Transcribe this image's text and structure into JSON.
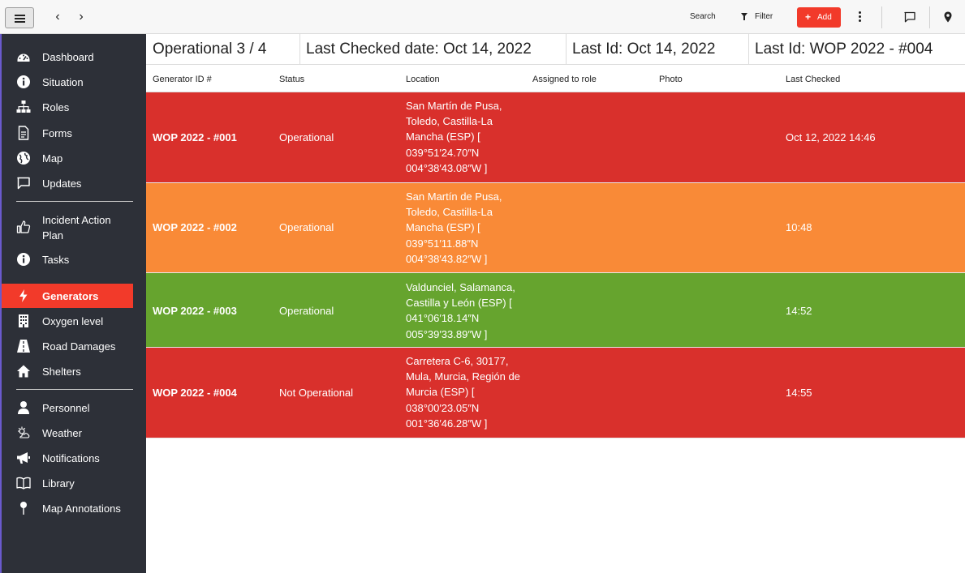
{
  "topbar": {
    "search_label": "Search",
    "filter_label": "Filter",
    "add_label": "Add"
  },
  "sidebar": {
    "items": [
      {
        "label": "Dashboard",
        "icon": "dashboard-icon"
      },
      {
        "label": "Situation",
        "icon": "info-icon"
      },
      {
        "label": "Roles",
        "icon": "org-chart-icon"
      },
      {
        "label": "Forms",
        "icon": "document-icon"
      },
      {
        "label": "Map",
        "icon": "globe-icon"
      },
      {
        "label": "Updates",
        "icon": "chat-icon"
      },
      {
        "label": "Incident Action Plan",
        "icon": "thumbs-up-icon"
      },
      {
        "label": "Tasks",
        "icon": "info-icon"
      },
      {
        "label": "Generators",
        "icon": "bolt-icon",
        "active": true
      },
      {
        "label": "Oxygen level",
        "icon": "building-icon"
      },
      {
        "label": "Road Damages",
        "icon": "road-icon"
      },
      {
        "label": "Shelters",
        "icon": "home-icon"
      },
      {
        "label": "Personnel",
        "icon": "person-icon"
      },
      {
        "label": "Weather",
        "icon": "weather-icon"
      },
      {
        "label": "Notifications",
        "icon": "megaphone-icon"
      },
      {
        "label": "Library",
        "icon": "book-icon"
      },
      {
        "label": "Map Annotations",
        "icon": "pin-icon"
      }
    ],
    "active_color": "#f23a2a",
    "background_color": "#2d3038"
  },
  "summary": {
    "operational": "Operational 3 / 4",
    "last_checked": "Last Checked date: Oct 14, 2022",
    "last_id_date": "Last Id: Oct 14, 2022",
    "last_id": "Last Id: WOP 2022 - #004"
  },
  "table": {
    "columns": [
      "Generator ID #",
      "Status",
      "Location",
      "Assigned to role",
      "Photo",
      "Last Checked"
    ],
    "rows": [
      {
        "id": "WOP 2022 - #001",
        "status": "Operational",
        "location": "San Martín de Pusa, Toledo, Castilla-La Mancha (ESP) [ 039°51′24.70″N 004°38′43.08″W ]",
        "role": "",
        "photo": "",
        "last_checked": "Oct 12, 2022 14:46",
        "color": "#d9302c"
      },
      {
        "id": "WOP 2022 - #002",
        "status": "Operational",
        "location": "San Martín de Pusa, Toledo, Castilla-La Mancha (ESP) [ 039°51′11.88″N 004°38′43.82″W ]",
        "role": "",
        "photo": "",
        "last_checked": "10:48",
        "color": "#f98a37"
      },
      {
        "id": "WOP 2022 - #003",
        "status": "Operational",
        "location": "Valdunciel, Salamanca, Castilla y León (ESP) [ 041°06′18.14″N 005°39′33.89″W ]",
        "role": "",
        "photo": "",
        "last_checked": "14:52",
        "color": "#66a42e"
      },
      {
        "id": "WOP 2022 - #004",
        "status": "Not Operational",
        "location": "Carretera C-6, 30177, Mula, Murcia, Región de Murcia (ESP) [ 038°00′23.05″N 001°36′46.28″W ]",
        "role": "",
        "photo": "",
        "last_checked": "14:55",
        "color": "#d9302c"
      }
    ]
  }
}
